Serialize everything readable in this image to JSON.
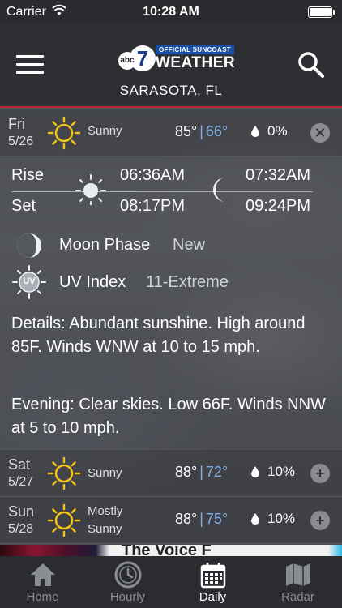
{
  "status_bar": {
    "carrier": "Carrier",
    "time": "10:28 AM",
    "battery_level": 1.0
  },
  "header": {
    "logo_badge": "OFFICIAL SUNCOAST",
    "logo_word": "WEATHER",
    "logo_abc": "abc",
    "logo_number": "7",
    "location": "SARASOTA, FL"
  },
  "days": [
    {
      "day": "Fri",
      "date": "5/26",
      "condition": "Sunny",
      "high": "85°",
      "low": "66°",
      "precip": "0%",
      "button": "✕",
      "icon": "sun-icon"
    },
    {
      "day": "Sat",
      "date": "5/27",
      "condition": "Sunny",
      "high": "88°",
      "low": "72°",
      "precip": "10%",
      "button": "+",
      "icon": "sun-icon"
    },
    {
      "day": "Sun",
      "date": "5/28",
      "condition_line1": "Mostly",
      "condition_line2": "Sunny",
      "high": "88°",
      "low": "75°",
      "precip": "10%",
      "button": "+",
      "icon": "sun-icon"
    }
  ],
  "separator": "|",
  "details": {
    "rise_label": "Rise",
    "set_label": "Set",
    "sunrise": "06:36AM",
    "sunset": "08:17PM",
    "moonrise": "07:32AM",
    "moonset": "09:24PM",
    "moon_phase_label": "Moon Phase",
    "moon_phase_value": "New",
    "uv_label": "UV Index",
    "uv_value": "11-Extreme",
    "uv_icon_text": "UV",
    "day_text": "Details: Abundant sunshine. High around 85F. Winds WNW at 10 to 15 mph.",
    "evening_text": "Evening: Clear skies. Low 66F. Winds NNW at 5 to 10 mph."
  },
  "ad": {
    "text": "The Voice F"
  },
  "tabs": [
    {
      "label": "Home",
      "icon": "home-icon",
      "active": false
    },
    {
      "label": "Hourly",
      "icon": "clock-icon",
      "active": false
    },
    {
      "label": "Daily",
      "icon": "calendar-icon",
      "active": true
    },
    {
      "label": "Radar",
      "icon": "map-icon",
      "active": false
    }
  ],
  "colors": {
    "accent_red": "#c4232f",
    "low_temp_blue": "#7fb0e8",
    "sun_yellow": "#f2c418"
  }
}
